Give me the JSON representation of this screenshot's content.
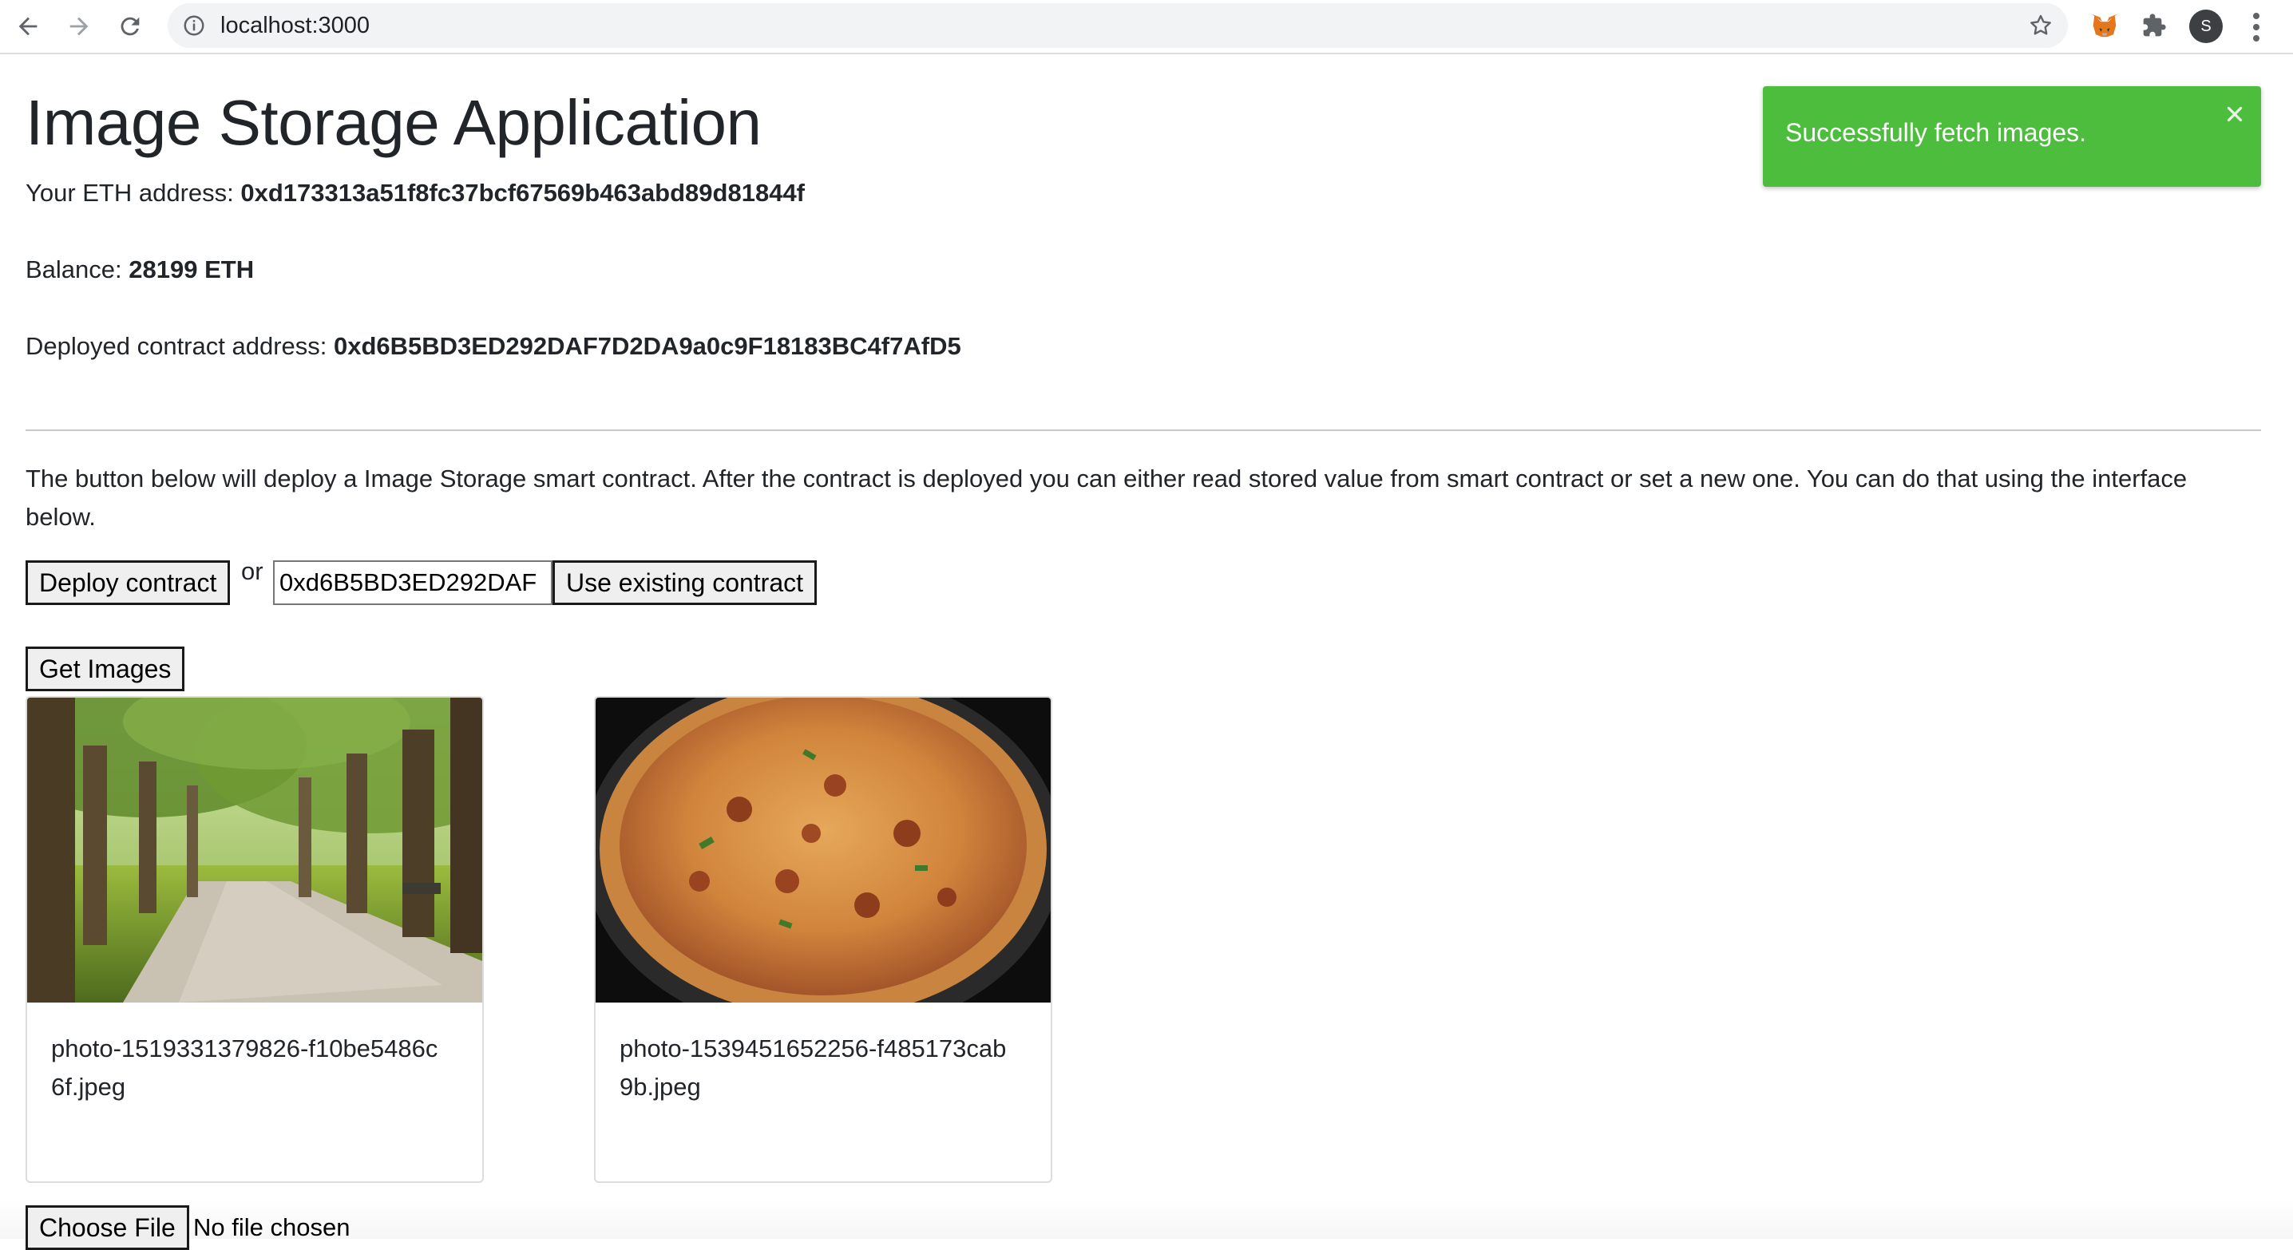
{
  "browser": {
    "url": "localhost:3000",
    "icons": [
      "back-arrow-icon",
      "forward-arrow-icon",
      "reload-icon",
      "info-icon",
      "star-icon",
      "metamask-fox-icon",
      "puzzle-extension-icon",
      "menu-kebab-icon"
    ],
    "profile_initial": "S"
  },
  "app": {
    "title": "Image Storage Application",
    "eth_address_label": "Your ETH address:",
    "eth_address": "0xd173313a51f8fc37bcf67569b463abd89d81844f",
    "balance_label": "Balance:",
    "balance": "28199 ETH",
    "contract_label": "Deployed contract address:",
    "contract_address": "0xd6B5BD3ED292DAF7D2DA9a0c9F18183BC4f7AfD5",
    "description": "The button below will deploy a Image Storage smart contract. After the contract is deployed you can either read stored value from smart contract or set a new one. You can do that using the interface below.",
    "deploy_button": "Deploy contract",
    "or_text": "or",
    "contract_input_value": "0xd6B5BD3ED292DAF",
    "use_existing_button": "Use existing contract",
    "get_images_button": "Get Images",
    "images": [
      {
        "filename": "photo-1519331379826-f10be5486c6f.jpeg",
        "depicts": "park-path-photo"
      },
      {
        "filename": "photo-1539451652256-f485173cab9b.jpeg",
        "depicts": "pizza-photo"
      }
    ],
    "choose_file_button": "Choose File",
    "no_file_text": "No file chosen"
  },
  "toast": {
    "message": "Successfully fetch images.",
    "color": "#4dbd3d"
  }
}
